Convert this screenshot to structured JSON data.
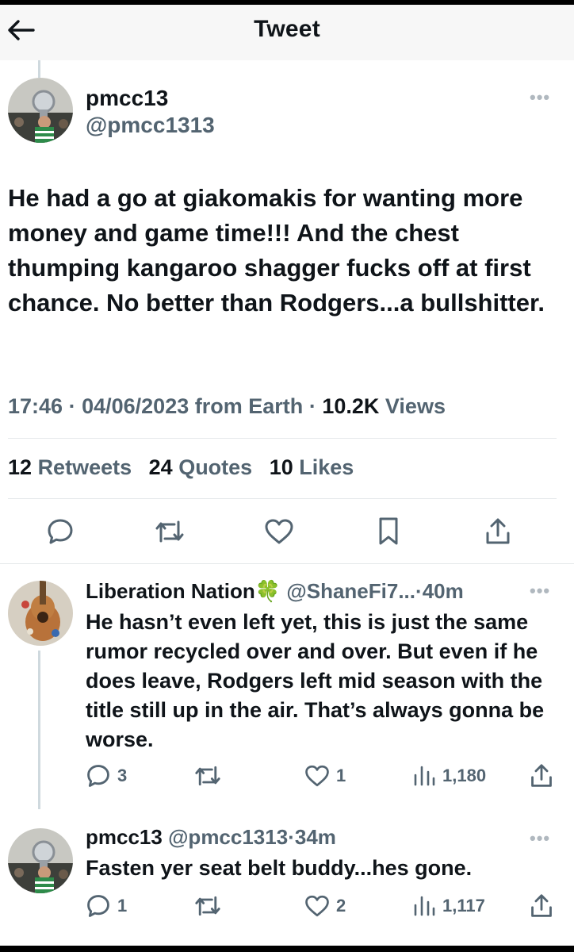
{
  "header": {
    "title": "Tweet"
  },
  "main_tweet": {
    "display_name": "pmcc13",
    "handle": "@pmcc1313",
    "more": "•••",
    "text": "He had a go at giakomakis for wanting more money and game time!!! And the chest thumping kangaroo shagger fucks off at first chance. No better than Rodgers...a bullshitter.",
    "time": "17:46",
    "date": "04/06/2023",
    "source_prefix": "from",
    "source": "Earth",
    "views_count": "10.2K",
    "views_label": "Views",
    "retweets_count": "12",
    "retweets_label": "Retweets",
    "quotes_count": "24",
    "quotes_label": "Quotes",
    "likes_count": "10",
    "likes_label": "Likes"
  },
  "replies": [
    {
      "display_name": "Liberation Nation",
      "emoji": "🍀",
      "handle": "@ShaneFi7...",
      "age": "40m",
      "more": "•••",
      "text": "He hasn’t even left yet, this is just the same rumor recycled over and over. But even if he does leave, Rodgers left mid season with the title still up in the air. That’s always gonna be worse.",
      "reply_count": "3",
      "retweet_count": "",
      "like_count": "1",
      "view_count": "1,180"
    },
    {
      "display_name": "pmcc13",
      "handle": "@pmcc1313",
      "age": "34m",
      "more": "•••",
      "text": "Fasten yer seat belt buddy...hes gone.",
      "reply_count": "1",
      "retweet_count": "",
      "like_count": "2",
      "view_count": "1,117"
    }
  ],
  "separator": "·",
  "colors": {
    "text": "#0f1419",
    "secondary": "#536471",
    "divider": "#e6e9eb",
    "header_bg": "#f7f7f7"
  }
}
